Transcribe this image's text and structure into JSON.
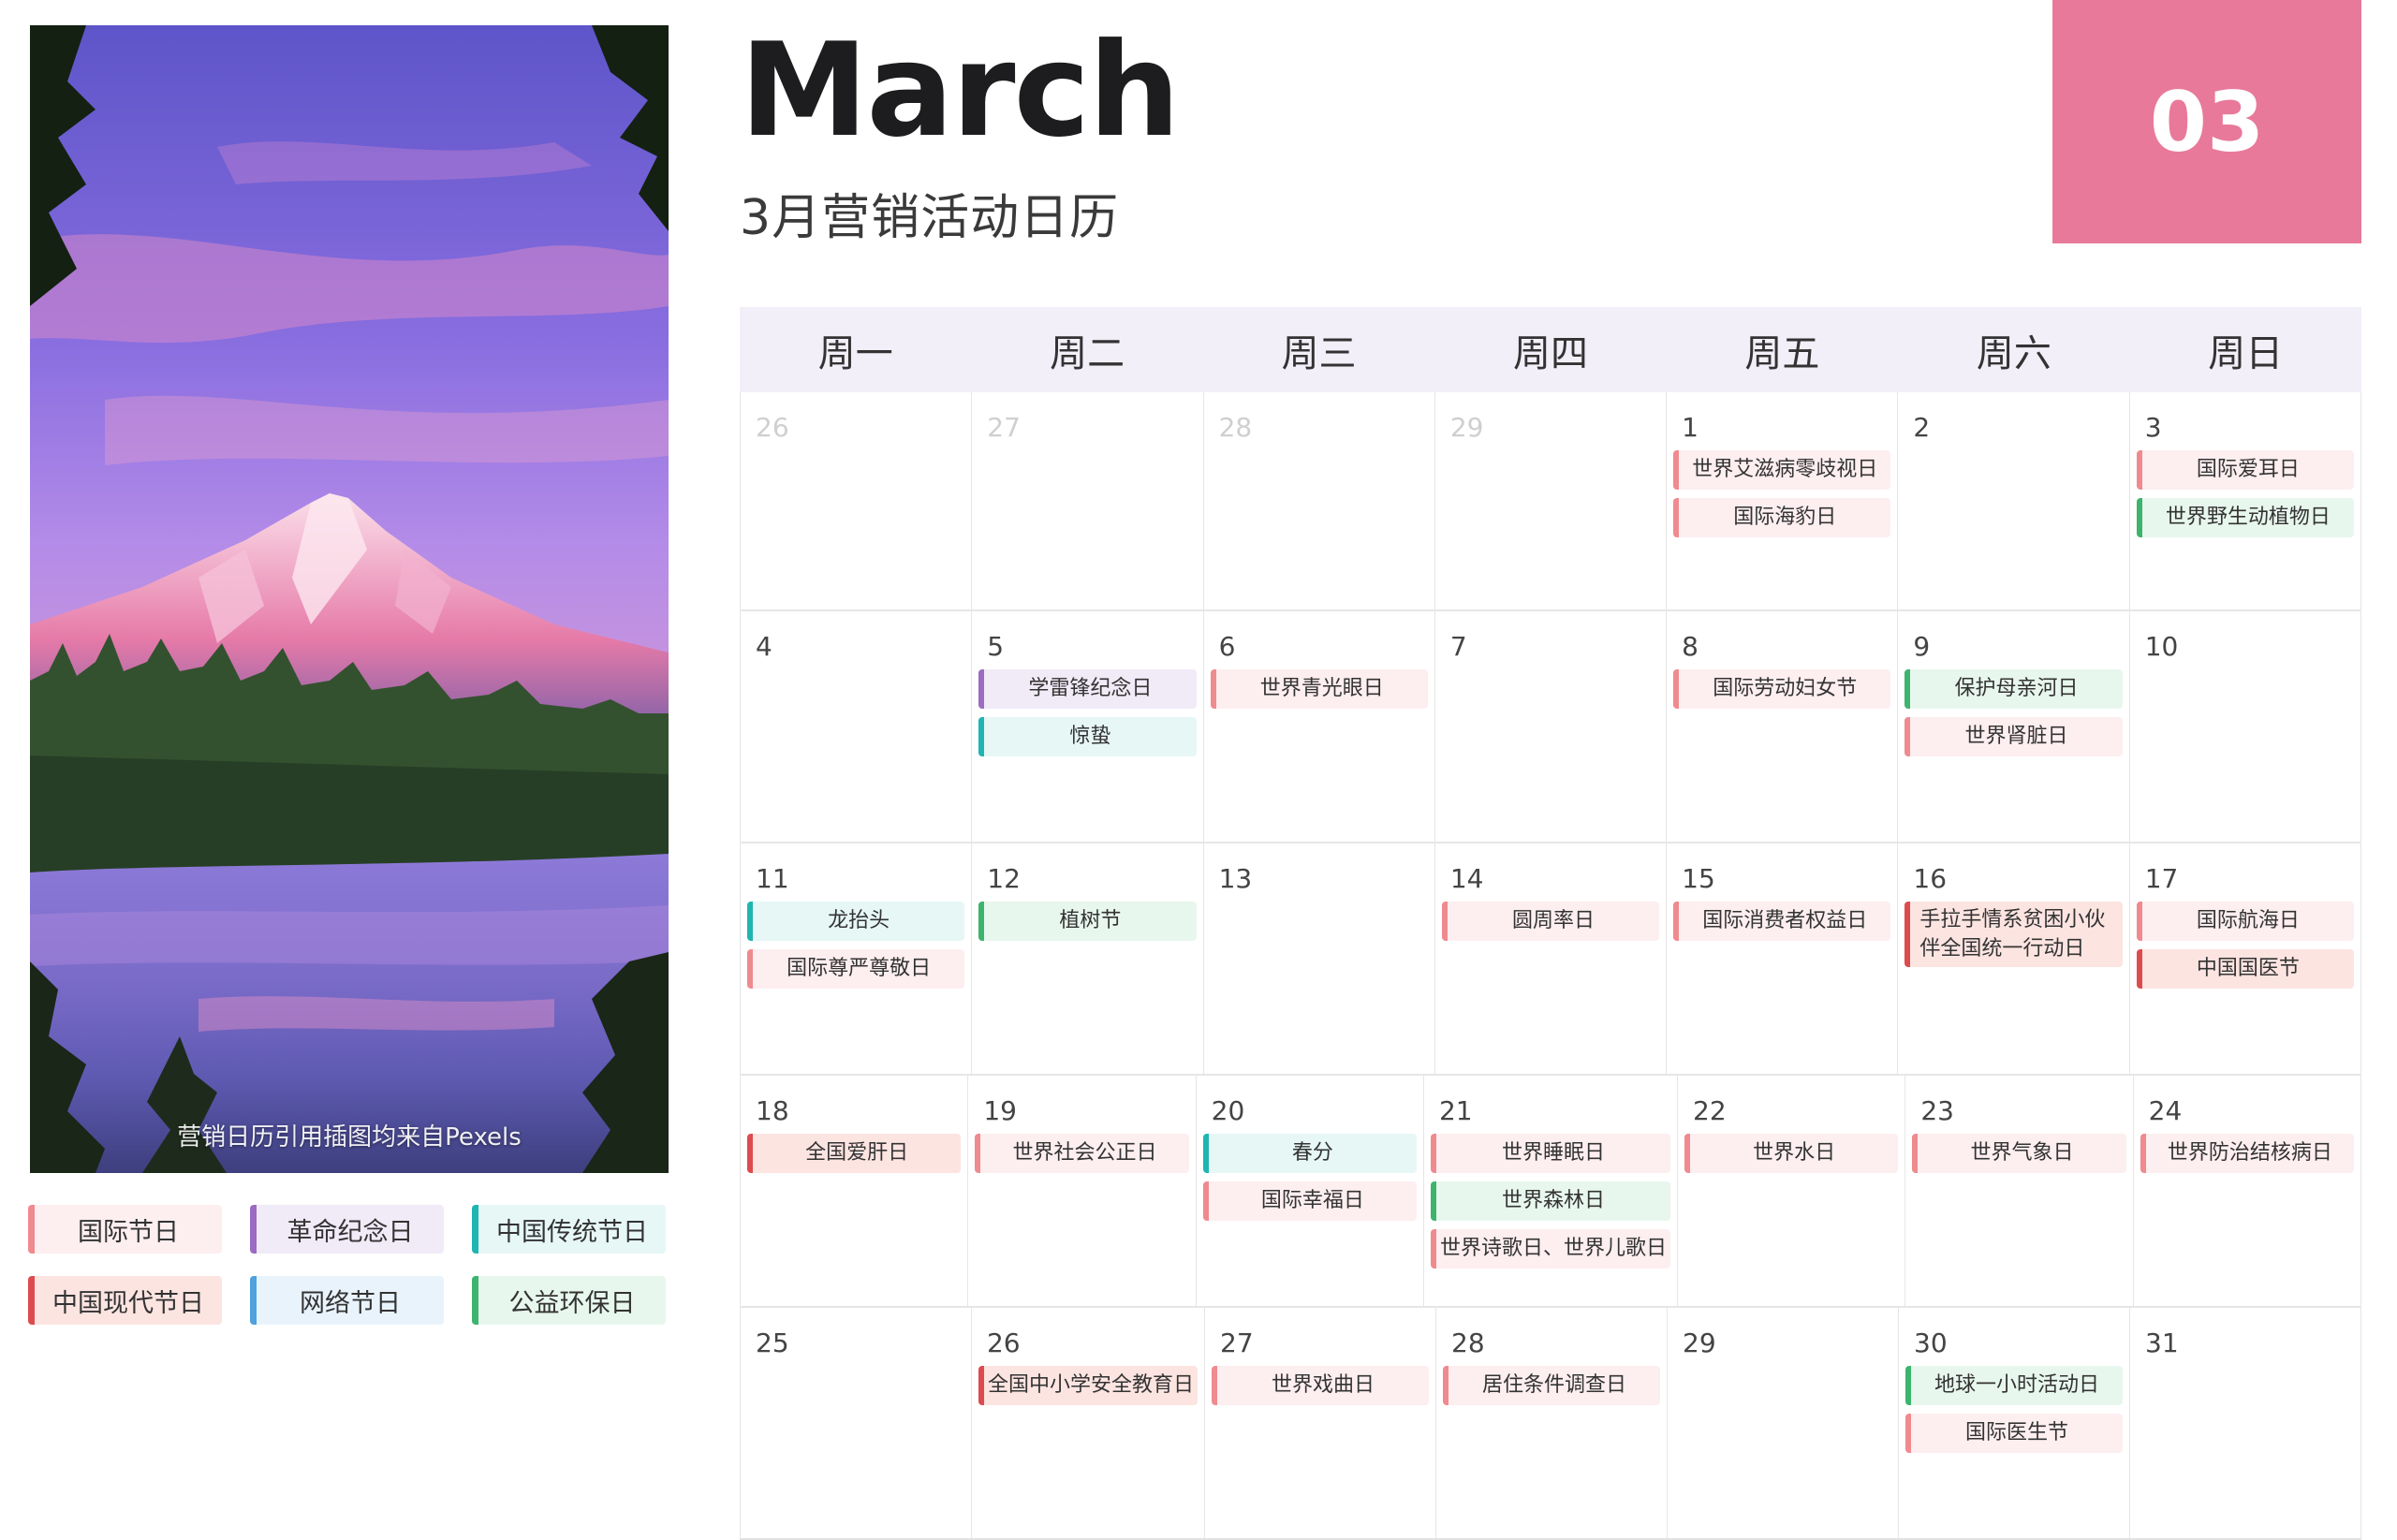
{
  "header": {
    "month_en": "March",
    "subtitle": "3月营销活动日历",
    "month_number": "03"
  },
  "photo": {
    "caption": "营销日历引用插图均来自Pexels"
  },
  "colors": {
    "badge": "#e8799a",
    "weekday_bar": "#f3eff9",
    "intl": "#ef8a8f",
    "rev": "#9b6cc2",
    "trad": "#1fb5b1",
    "modern": "#dd4b4e",
    "net": "#4fa2dd",
    "eco": "#3cb46e"
  },
  "legend": [
    {
      "label": "国际节日",
      "cat": "intl"
    },
    {
      "label": "革命纪念日",
      "cat": "rev"
    },
    {
      "label": "中国传统节日",
      "cat": "trad"
    },
    {
      "label": "中国现代节日",
      "cat": "modern"
    },
    {
      "label": "网络节日",
      "cat": "net"
    },
    {
      "label": "公益环保日",
      "cat": "eco"
    }
  ],
  "weekdays": [
    "周一",
    "周二",
    "周三",
    "周四",
    "周五",
    "周六",
    "周日"
  ],
  "weeks": [
    [
      {
        "day": "26",
        "muted": true,
        "events": []
      },
      {
        "day": "27",
        "muted": true,
        "events": []
      },
      {
        "day": "28",
        "muted": true,
        "events": []
      },
      {
        "day": "29",
        "muted": true,
        "events": []
      },
      {
        "day": "1",
        "events": [
          {
            "label": "世界艾滋病零歧视日",
            "cat": "intl"
          },
          {
            "label": "国际海豹日",
            "cat": "intl"
          }
        ]
      },
      {
        "day": "2",
        "events": []
      },
      {
        "day": "3",
        "events": [
          {
            "label": "国际爱耳日",
            "cat": "intl"
          },
          {
            "label": "世界野生动植物日",
            "cat": "eco"
          }
        ]
      }
    ],
    [
      {
        "day": "4",
        "events": []
      },
      {
        "day": "5",
        "events": [
          {
            "label": "学雷锋纪念日",
            "cat": "rev"
          },
          {
            "label": "惊蛰",
            "cat": "trad"
          }
        ]
      },
      {
        "day": "6",
        "events": [
          {
            "label": "世界青光眼日",
            "cat": "intl"
          }
        ]
      },
      {
        "day": "7",
        "events": []
      },
      {
        "day": "8",
        "events": [
          {
            "label": "国际劳动妇女节",
            "cat": "intl"
          }
        ]
      },
      {
        "day": "9",
        "events": [
          {
            "label": "保护母亲河日",
            "cat": "eco"
          },
          {
            "label": "世界肾脏日",
            "cat": "intl"
          }
        ]
      },
      {
        "day": "10",
        "events": []
      }
    ],
    [
      {
        "day": "11",
        "events": [
          {
            "label": "龙抬头",
            "cat": "trad"
          },
          {
            "label": "国际尊严尊敬日",
            "cat": "intl"
          }
        ]
      },
      {
        "day": "12",
        "events": [
          {
            "label": "植树节",
            "cat": "eco"
          }
        ]
      },
      {
        "day": "13",
        "events": []
      },
      {
        "day": "14",
        "events": [
          {
            "label": "圆周率日",
            "cat": "intl"
          }
        ]
      },
      {
        "day": "15",
        "events": [
          {
            "label": "国际消费者权益日",
            "cat": "intl"
          }
        ]
      },
      {
        "day": "16",
        "events": [
          {
            "label": "手拉手情系贫困小伙伴全国统一行动日",
            "cat": "modern",
            "multiline": true
          }
        ]
      },
      {
        "day": "17",
        "events": [
          {
            "label": "国际航海日",
            "cat": "intl"
          },
          {
            "label": "中国国医节",
            "cat": "modern"
          }
        ]
      }
    ],
    [
      {
        "day": "18",
        "events": [
          {
            "label": "全国爱肝日",
            "cat": "modern"
          }
        ]
      },
      {
        "day": "19",
        "events": [
          {
            "label": "世界社会公正日",
            "cat": "intl"
          }
        ]
      },
      {
        "day": "20",
        "events": [
          {
            "label": "春分",
            "cat": "trad"
          },
          {
            "label": "国际幸福日",
            "cat": "intl"
          }
        ]
      },
      {
        "day": "21",
        "events": [
          {
            "label": "世界睡眠日",
            "cat": "intl"
          },
          {
            "label": "世界森林日",
            "cat": "eco"
          },
          {
            "label": "世界诗歌日、世界儿歌日",
            "cat": "intl"
          }
        ]
      },
      {
        "day": "22",
        "events": [
          {
            "label": "世界水日",
            "cat": "intl"
          }
        ]
      },
      {
        "day": "23",
        "events": [
          {
            "label": "世界气象日",
            "cat": "intl"
          }
        ]
      },
      {
        "day": "24",
        "events": [
          {
            "label": "世界防治结核病日",
            "cat": "intl"
          }
        ]
      }
    ],
    [
      {
        "day": "25",
        "events": []
      },
      {
        "day": "26",
        "events": [
          {
            "label": "全国中小学安全教育日",
            "cat": "modern"
          }
        ]
      },
      {
        "day": "27",
        "events": [
          {
            "label": "世界戏曲日",
            "cat": "intl"
          }
        ]
      },
      {
        "day": "28",
        "events": [
          {
            "label": "居住条件调查日",
            "cat": "intl"
          }
        ]
      },
      {
        "day": "29",
        "events": []
      },
      {
        "day": "30",
        "events": [
          {
            "label": "地球一小时活动日",
            "cat": "eco"
          },
          {
            "label": "国际医生节",
            "cat": "intl"
          }
        ]
      },
      {
        "day": "31",
        "events": []
      }
    ]
  ]
}
